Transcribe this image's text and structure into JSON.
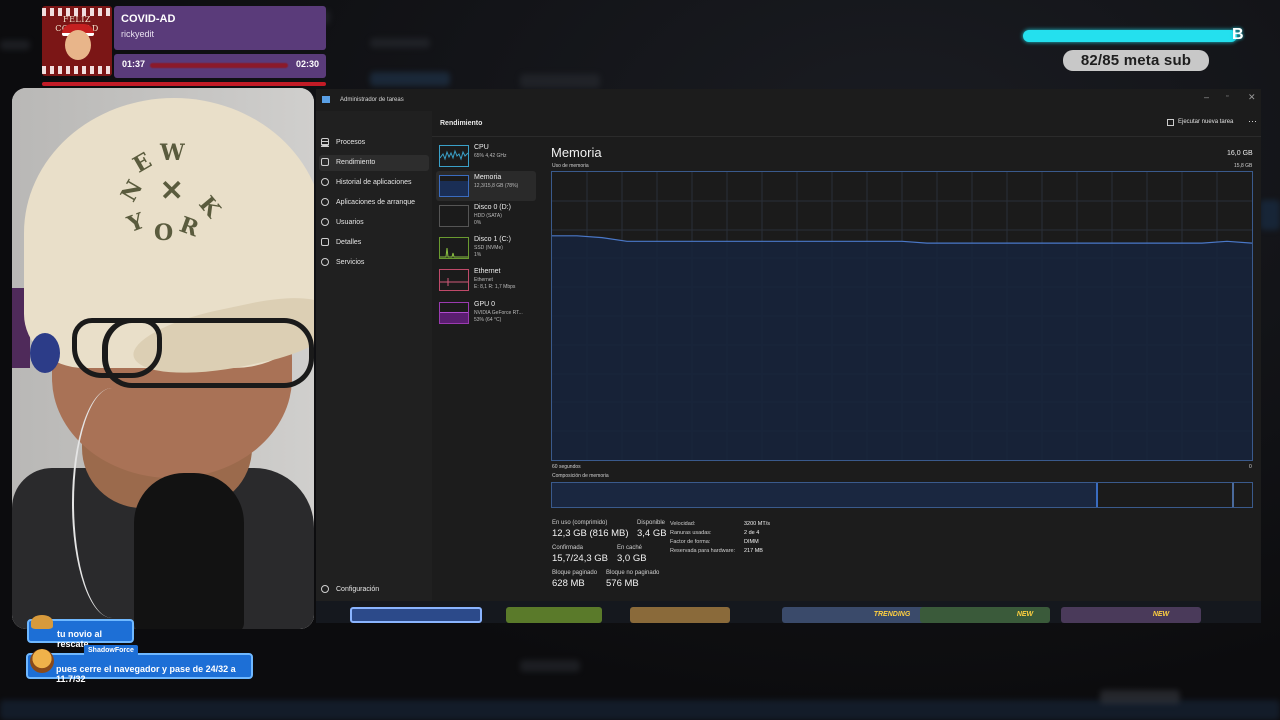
{
  "now_playing": {
    "art_text": "FELIZ COVIDAD",
    "song": "COVID-AD",
    "artist": "rickyedit",
    "time_elapsed": "01:37",
    "time_total": "02:30"
  },
  "sub_goal": {
    "label": "82/85 meta sub",
    "progress": 0.965,
    "accent": "#24e0ee"
  },
  "chat": [
    {
      "user": "",
      "message": "tu novio al rescate"
    },
    {
      "user": "ShadowForce",
      "message": "pues cerre el navegador y pase de 24/32 a 11.7/32"
    }
  ],
  "task_manager": {
    "window_title": "Administrador de tareas",
    "section": "Rendimiento",
    "run_task_label": "Ejecutar nueva tarea",
    "nav": [
      {
        "label": "Procesos",
        "icon": "grid-icon"
      },
      {
        "label": "Rendimiento",
        "icon": "performance-icon",
        "active": true
      },
      {
        "label": "Historial de aplicaciones",
        "icon": "history-icon"
      },
      {
        "label": "Aplicaciones de arranque",
        "icon": "startup-icon"
      },
      {
        "label": "Usuarios",
        "icon": "users-icon"
      },
      {
        "label": "Detalles",
        "icon": "details-icon"
      },
      {
        "label": "Servicios",
        "icon": "services-icon"
      }
    ],
    "settings_label": "Configuración",
    "resources": [
      {
        "name": "CPU",
        "sub1": "65% 4,42 GHz",
        "sub2": "",
        "color": "#3aa0c8"
      },
      {
        "name": "Memoria",
        "sub1": "12,3/15,8 GB (78%)",
        "sub2": "",
        "color": "#3a6cc0",
        "active": true
      },
      {
        "name": "Disco 0 (D:)",
        "sub1": "HDD (SATA)",
        "sub2": "0%",
        "color": "#6a9a30"
      },
      {
        "name": "Disco 1 (C:)",
        "sub1": "SSD (NVMe)",
        "sub2": "1%",
        "color": "#7aa830"
      },
      {
        "name": "Ethernet",
        "sub1": "Ethernet",
        "sub2": "E: 8,1 R: 1,7 Mbps",
        "color": "#c04a6a"
      },
      {
        "name": "GPU 0",
        "sub1": "NVIDIA GeForce RT...",
        "sub2": "53% (64 °C)",
        "color": "#9a3ab0"
      }
    ],
    "memory": {
      "title": "Memoria",
      "total": "16,0 GB",
      "usage_label": "Uso de memoria",
      "usage_max": "15,8 GB",
      "time_left": "60 segundos",
      "time_right": "0",
      "composition_label": "Composición de memoria",
      "usage_series": [
        12.3,
        12.3,
        12.2,
        12.0,
        12.0,
        12.0,
        12.0,
        12.0,
        12.0,
        12.0,
        12.0,
        12.0,
        12.0,
        12.0,
        12.0,
        11.9,
        11.9,
        11.9,
        11.9,
        11.9,
        11.9,
        11.9,
        11.9,
        11.9,
        11.9,
        11.9,
        11.9,
        12.0,
        11.9
      ],
      "composition_used_fraction": 0.78,
      "stats": {
        "in_use_label": "En uso (comprimido)",
        "in_use": "12,3 GB (816 MB)",
        "available_label": "Disponible",
        "available": "3,4 GB",
        "committed_label": "Confirmada",
        "committed": "15,7/24,3 GB",
        "cached_label": "En caché",
        "cached": "3,0 GB",
        "paged_label": "Bloque paginado",
        "paged": "628 MB",
        "nonpaged_label": "Bloque no paginado",
        "nonpaged": "576 MB"
      },
      "details": [
        {
          "k": "Velocidad:",
          "v": "3200 MT/s"
        },
        {
          "k": "Ranuras usadas:",
          "v": "2 de 4"
        },
        {
          "k": "Factor de forma:",
          "v": "DIMM"
        },
        {
          "k": "Reservada para hardware:",
          "v": "217 MB"
        }
      ]
    }
  },
  "tiles": [
    "TRENDING",
    "NEW",
    "NEW"
  ]
}
